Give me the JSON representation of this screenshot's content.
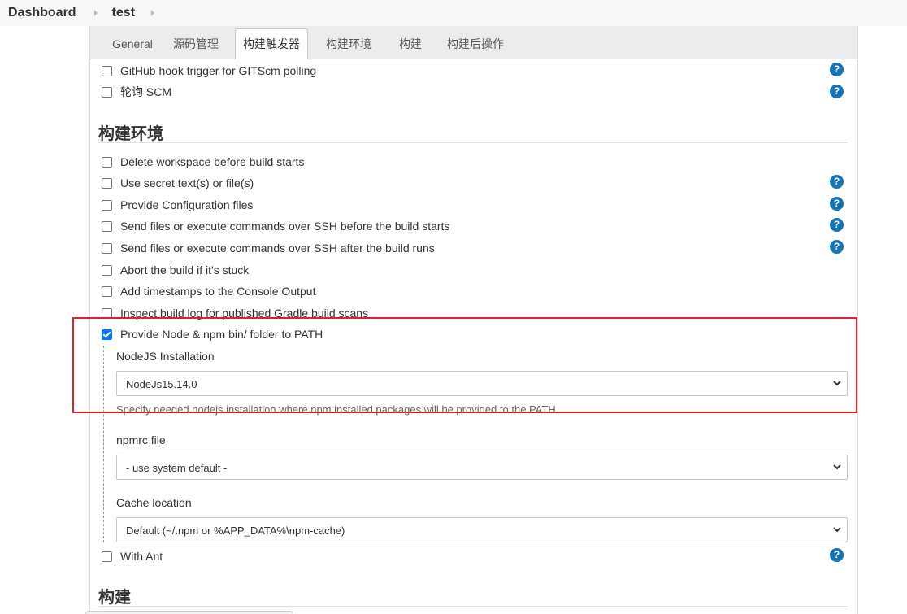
{
  "breadcrumb": {
    "dashboard": "Dashboard",
    "job": "test"
  },
  "tabs": [
    "General",
    "源码管理",
    "构建触发器",
    "构建环境",
    "构建",
    "构建后操作"
  ],
  "active_tab": "构建触发器",
  "triggers": [
    {
      "label": "GitHub hook trigger for GITScm polling",
      "checked": false,
      "help": true
    },
    {
      "label": "轮询 SCM",
      "checked": false,
      "help": true
    }
  ],
  "build_env": {
    "title": "构建环境",
    "options": [
      {
        "label": "Delete workspace before build starts",
        "checked": false,
        "help": false
      },
      {
        "label": "Use secret text(s) or file(s)",
        "checked": false,
        "help": true
      },
      {
        "label": "Provide Configuration files",
        "checked": false,
        "help": true
      },
      {
        "label": "Send files or execute commands over SSH before the build starts",
        "checked": false,
        "help": true
      },
      {
        "label": "Send files or execute commands over SSH after the build runs",
        "checked": false,
        "help": true
      },
      {
        "label": "Abort the build if it's stuck",
        "checked": false,
        "help": false
      },
      {
        "label": "Add timestamps to the Console Output",
        "checked": false,
        "help": false
      },
      {
        "label": "Inspect build log for published Gradle build scans",
        "checked": false,
        "help": false
      },
      {
        "label": "Provide Node & npm bin/ folder to PATH",
        "checked": true,
        "help": false
      }
    ],
    "node": {
      "installation_label": "NodeJS Installation",
      "installation_value": "NodeJs15.14.0",
      "installation_hint": "Specify needed nodejs installation where npm installed packages will be provided to the PATH",
      "npmrc_label": "npmrc file",
      "npmrc_value": "- use system default -",
      "cache_label": "Cache location",
      "cache_value": "Default (~/.npm or %APP_DATA%\\npm-cache)"
    },
    "with_ant": {
      "label": "With Ant",
      "checked": false,
      "help": true
    }
  },
  "build": {
    "title": "构建"
  },
  "help_glyph": "?",
  "colors": {
    "help": "#1473b4",
    "checkbox_checked": "#0075ff",
    "highlight": "#e0202a"
  }
}
